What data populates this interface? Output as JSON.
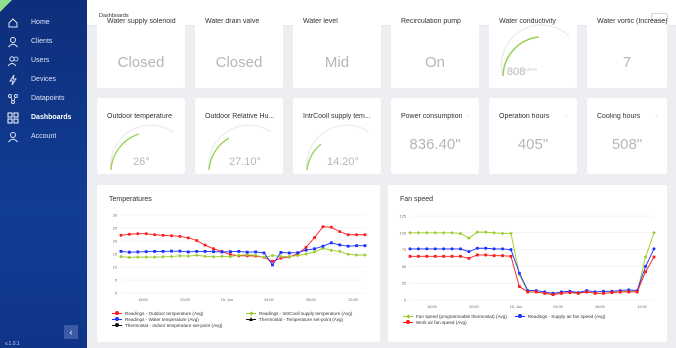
{
  "sidebar": {
    "items": [
      {
        "label": "Home",
        "icon": "home-icon"
      },
      {
        "label": "Clients",
        "icon": "person-icon"
      },
      {
        "label": "Users",
        "icon": "users-icon"
      },
      {
        "label": "Devices",
        "icon": "devices-icon"
      },
      {
        "label": "Datapoints",
        "icon": "datapoints-icon"
      },
      {
        "label": "Dashboards",
        "icon": "dashboard-icon"
      },
      {
        "label": "Account",
        "icon": "account-icon"
      }
    ],
    "active": "Dashboards",
    "collapse_glyph": "‹",
    "footer": "v.1.0.1"
  },
  "topbar": {
    "title": "Dashboards",
    "close_glyph": "×",
    "action_label": "···· ·· ····"
  },
  "top_cards": [
    {
      "title": "Water supply solenoid",
      "value": "Closed"
    },
    {
      "title": "Water drain valve",
      "value": "Closed"
    },
    {
      "title": "Water level",
      "value": "Mid"
    },
    {
      "title": "Recirculation pump",
      "value": "On"
    },
    {
      "title": "Water conductivity",
      "value": "808",
      "unit": "µS/cm",
      "gauge_level": 0.45
    },
    {
      "title": "Water vortic (Increase)",
      "value": "7"
    }
  ],
  "mid_cards": [
    {
      "title": "Outdoor temperature",
      "value": "26°",
      "gauge_level": 0.45
    },
    {
      "title": "Outdoor Relative Hu...",
      "value": "27.10°",
      "gauge_level": 0.35
    },
    {
      "title": "IntrCooll supply tem...",
      "value": "14.20°",
      "gauge_level": 0.25
    },
    {
      "title": "Power consumption",
      "value": "836.40\""
    },
    {
      "title": "Operation hours",
      "value": "405\""
    },
    {
      "title": "Cooling hours",
      "value": "508\""
    }
  ],
  "colors": {
    "accent_green": "#9bd25b",
    "red": "#ff1a1a",
    "blue": "#1a2eff",
    "olive": "#9ccc2a",
    "black": "#111111"
  },
  "temperatures": {
    "title": "Temperatures",
    "legend": [
      {
        "label": "Readings - Outdoor temperature (Avg)",
        "color": "#ff1a1a",
        "marker": "circle"
      },
      {
        "label": "Readings - IntrCooll supply temperature (Avg)",
        "color": "#9ccc2a",
        "marker": "diamond"
      },
      {
        "label": "Readings - Water temperature (Avg)",
        "color": "#1a2eff",
        "marker": "square"
      },
      {
        "label": "Thermostat - Temperature set-point (Avg)",
        "color": "#111111",
        "marker": "triangle"
      },
      {
        "label": "Thermostat - Indoor temperature set-point (Avg)",
        "color": "#111111",
        "marker": "circle"
      }
    ]
  },
  "fan_speed": {
    "title": "Fan speed",
    "legend": [
      {
        "label": "Fan speed (programmable thermostat) (Avg)",
        "color": "#9ccc2a",
        "marker": "diamond"
      },
      {
        "label": "Readings - Supply air fan speed (Avg)",
        "color": "#1a2eff",
        "marker": "circle"
      },
      {
        "label": "Work air fan speed (Avg)",
        "color": "#ff1a1a",
        "marker": "square"
      }
    ]
  },
  "chart_data": [
    {
      "type": "line",
      "title": "Temperatures",
      "xlabel": "",
      "ylabel": "",
      "ylim": [
        0,
        30
      ],
      "yticks": [
        "0",
        "5",
        "10",
        "15",
        "20",
        "25",
        "30"
      ],
      "xticks": [
        "15:00",
        "20:00",
        "15. Jun",
        "04:00",
        "08:00",
        "12:00"
      ],
      "grid": true,
      "legend_position": "bottom",
      "x": [
        0,
        1,
        2,
        3,
        4,
        5,
        6,
        7,
        8,
        9,
        10,
        11,
        12,
        13,
        14,
        15,
        16,
        17,
        18,
        19,
        20,
        21,
        22,
        23,
        24,
        25,
        26,
        27,
        28,
        29
      ],
      "series": [
        {
          "name": "Readings - Outdoor temperature (Avg)",
          "color": "#ff1a1a",
          "values": [
            22.2,
            22.6,
            22.8,
            22.8,
            22.4,
            22.2,
            22.0,
            21.8,
            21.2,
            20.2,
            18.4,
            17.0,
            16.0,
            14.8,
            14.3,
            14.3,
            14.2,
            13.7,
            12.2,
            13.4,
            13.9,
            15.0,
            17.6,
            21.3,
            25.5,
            25.3,
            23.6,
            22.4,
            22.4,
            22.4
          ]
        },
        {
          "name": "Readings - IntrCooll supply temperature (Avg)",
          "color": "#9ccc2a",
          "values": [
            14.0,
            13.7,
            13.8,
            13.8,
            13.8,
            13.9,
            14.0,
            14.3,
            14.2,
            14.5,
            14.1,
            13.9,
            14.1,
            14.0,
            14.5,
            14.7,
            14.5,
            13.7,
            14.4,
            14.1,
            14.0,
            14.4,
            15.0,
            15.8,
            17.2,
            16.4,
            16.0,
            14.9,
            14.6,
            14.6
          ]
        },
        {
          "name": "Readings - Water temperature (Avg)",
          "color": "#1a2eff",
          "values": [
            16.0,
            15.7,
            15.8,
            15.9,
            16.0,
            16.0,
            16.1,
            16.1,
            15.8,
            16.0,
            16.0,
            15.9,
            15.8,
            15.9,
            16.0,
            15.7,
            15.8,
            15.4,
            10.8,
            15.6,
            15.4,
            15.5,
            16.5,
            17.0,
            18.0,
            19.3,
            18.5,
            18.0,
            18.2,
            18.2
          ]
        }
      ]
    },
    {
      "type": "line",
      "title": "Fan speed",
      "xlabel": "",
      "ylabel": "",
      "ylim": [
        0,
        125
      ],
      "yticks": [
        "0",
        "25",
        "50",
        "75",
        "100",
        "125"
      ],
      "xticks": [
        "15:00",
        "20:00",
        "15. Jun",
        "04:00",
        "08:00",
        "12:00"
      ],
      "grid": true,
      "legend_position": "bottom",
      "x": [
        0,
        1,
        2,
        3,
        4,
        5,
        6,
        7,
        8,
        9,
        10,
        11,
        12,
        13,
        14,
        15,
        16,
        17,
        18,
        19,
        20,
        21,
        22,
        23,
        24,
        25,
        26,
        27,
        28,
        29
      ],
      "series": [
        {
          "name": "Fan speed (programmable thermostat) (Avg)",
          "color": "#9ccc2a",
          "values": [
            100,
            100,
            100,
            100,
            100,
            100,
            99,
            92,
            101,
            101,
            100,
            99,
            99,
            38,
            12,
            12,
            10,
            8,
            10,
            11,
            10,
            12,
            10,
            10,
            11,
            12,
            13,
            12,
            64,
            100
          ]
        },
        {
          "name": "Readings - Supply air fan speed (Avg)",
          "color": "#1a2eff",
          "values": [
            76,
            76,
            76,
            76,
            76,
            76,
            76,
            72,
            77,
            77,
            76,
            76,
            75,
            40,
            14,
            14,
            12,
            10,
            12,
            13,
            11,
            14,
            12,
            13,
            13,
            14,
            15,
            14,
            50,
            76
          ]
        },
        {
          "name": "Work air fan speed (Avg)",
          "color": "#ff1a1a",
          "values": [
            65,
            65,
            65,
            65,
            65,
            65,
            65,
            62,
            67,
            67,
            66,
            66,
            65,
            20,
            12,
            12,
            10,
            8,
            10,
            11,
            10,
            12,
            10,
            10,
            11,
            12,
            12,
            12,
            42,
            64
          ]
        }
      ]
    }
  ]
}
